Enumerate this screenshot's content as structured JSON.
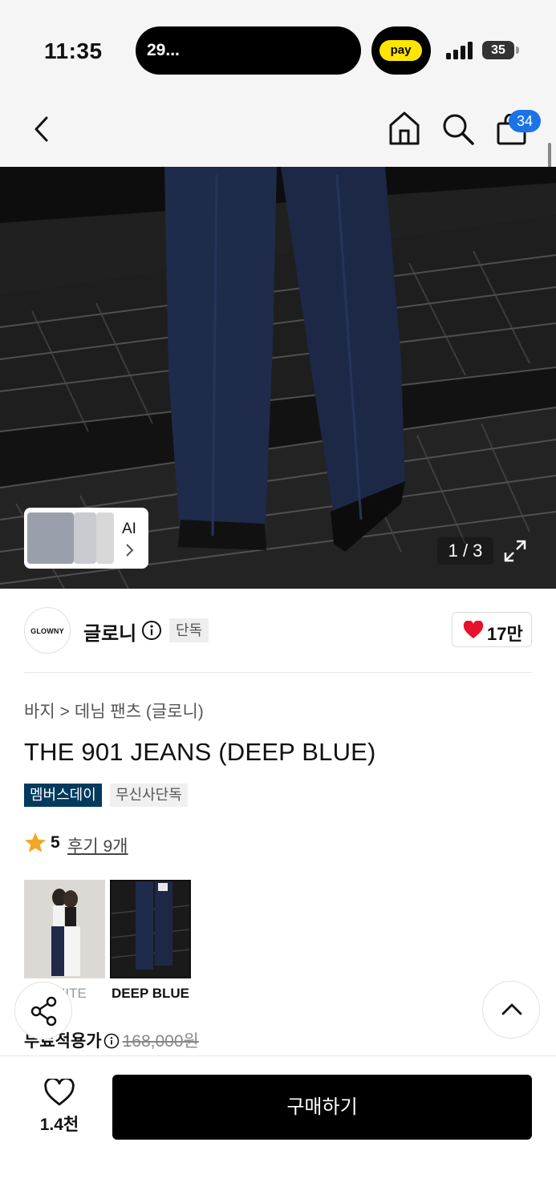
{
  "status_bar": {
    "time": "11:35",
    "island_text": "29...",
    "pay_label": "pay",
    "battery": "35"
  },
  "nav": {
    "cart_count": "34"
  },
  "hero": {
    "pager": "1 / 3",
    "ai_label": "AI"
  },
  "brand": {
    "logo_text": "GLOWNY",
    "name": "글로니",
    "exclusive_tag": "단독",
    "likes": "17만"
  },
  "breadcrumb": {
    "category": "바지",
    "subcategory": "데님 팬츠 (글로니)"
  },
  "product": {
    "title": "THE 901 JEANS (DEEP BLUE)",
    "tags": [
      "멤버스데이",
      "무신사단독"
    ],
    "rating": "5",
    "reviews": "후기 9개"
  },
  "colors": [
    {
      "label": "WHITE",
      "selected": false
    },
    {
      "label": "DEEP BLUE",
      "selected": true
    }
  ],
  "price": {
    "label": "무료적용가",
    "original": "168,000원"
  },
  "bottom_bar": {
    "wish_count": "1.4천",
    "buy_label": "구매하기"
  },
  "colors_theme": {
    "accent_blue": "#1a73e8",
    "member_tag": "#003a5c",
    "heart_red": "#e8112d",
    "star": "#f5a623"
  }
}
